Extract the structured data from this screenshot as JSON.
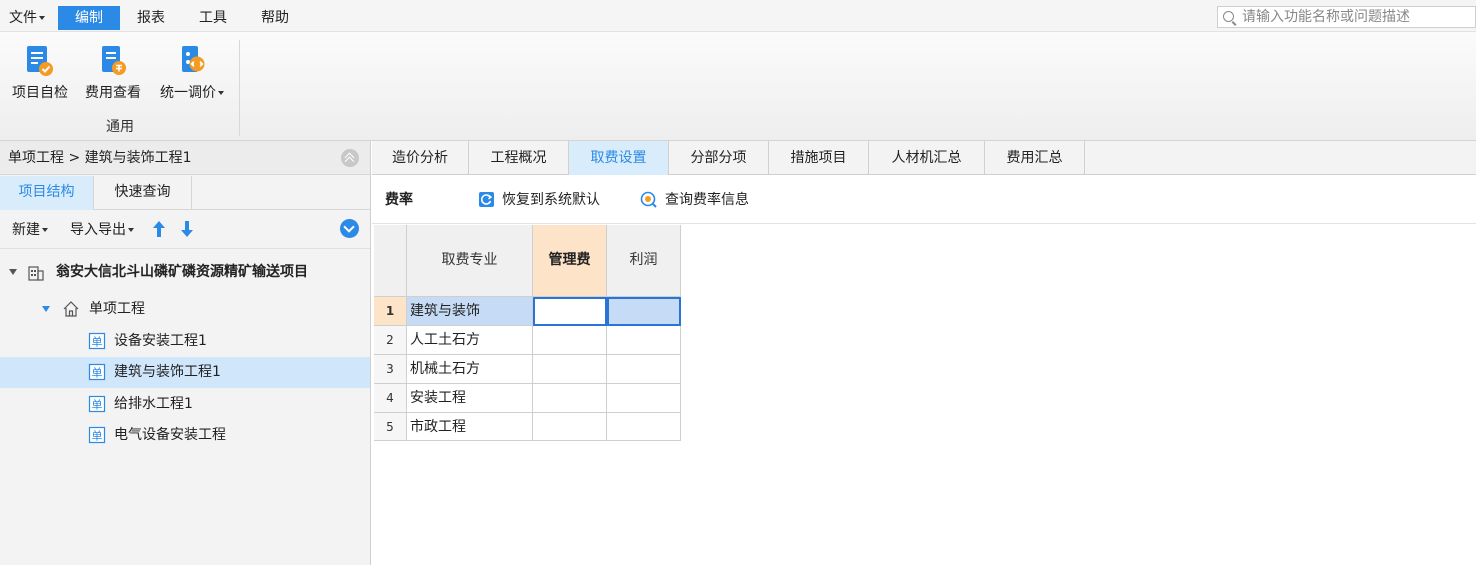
{
  "menu": {
    "file": "文件",
    "edit": "编制",
    "report": "报表",
    "tools": "工具",
    "help": "帮助"
  },
  "search": {
    "placeholder": "请输入功能名称或问题描述"
  },
  "ribbon": {
    "self_check": "项目自检",
    "fee_view": "费用查看",
    "unify_price": "统一调价",
    "group_label": "通用"
  },
  "left": {
    "breadcrumb": "单项工程 > 建筑与装饰工程1",
    "tabs": [
      "项目结构",
      "快速查询"
    ],
    "toolbar": {
      "new": "新建",
      "import_export": "导入导出"
    },
    "tree": {
      "project": "翁安大信北斗山磷矿磷资源精矿输送项目",
      "single": "单项工程",
      "units": [
        "设备安装工程1",
        "建筑与装饰工程1",
        "给排水工程1",
        "电气设备安装工程"
      ]
    },
    "unit_badge": "单"
  },
  "main": {
    "tabs": [
      "造价分析",
      "工程概况",
      "取费设置",
      "分部分项",
      "措施项目",
      "人材机汇总",
      "费用汇总"
    ],
    "subbar": {
      "title": "费率",
      "restore": "恢复到系统默认",
      "query": "查询费率信息"
    },
    "grid": {
      "headers": [
        "取费专业",
        "管理费",
        "利润"
      ],
      "rows": [
        {
          "num": "1",
          "name": "建筑与装饰"
        },
        {
          "num": "2",
          "name": "人工土石方"
        },
        {
          "num": "3",
          "name": "机械土石方"
        },
        {
          "num": "4",
          "name": "安装工程"
        },
        {
          "num": "5",
          "name": "市政工程"
        }
      ]
    }
  },
  "colors": {
    "accent": "#2b8ae6",
    "tab_active_bg": "#d9ecfc",
    "header_highlight": "#fde3c8"
  }
}
